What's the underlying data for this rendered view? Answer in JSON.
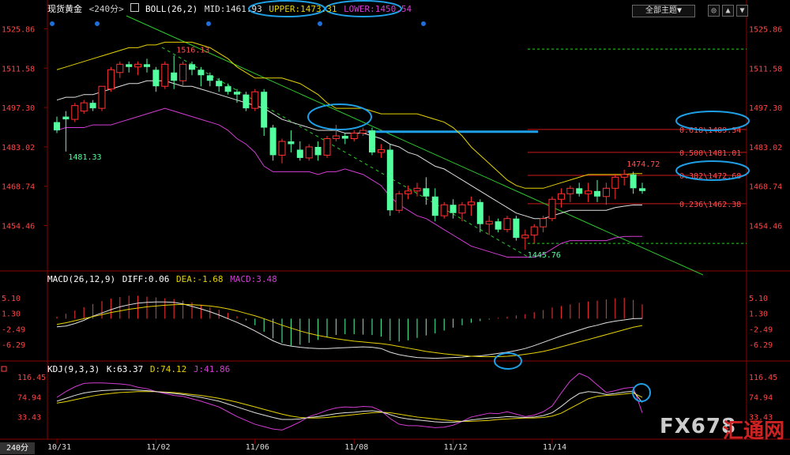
{
  "header": {
    "symbol": "现货黄金",
    "period": "<240分>",
    "indicator": "BOLL(26,2)",
    "mid": "MID:1461.93",
    "upper": "UPPER:1473.31",
    "lower": "LOWER:1450.54"
  },
  "toolbar": {
    "theme_label": "全部主题▼",
    "btn1": "◎",
    "btn2": "▲",
    "btn3": "▼"
  },
  "period_tab": "240分",
  "watermark": {
    "brand": "FX678",
    "cn": "汇通网"
  },
  "macd_header": {
    "name": "MACD(26,12,9)",
    "diff": "DIFF:0.06",
    "dea": "DEA:-1.68",
    "macd": "MACD:3.48"
  },
  "kdj_header": {
    "name": "KDJ(9,3,3)",
    "k": "K:63.37",
    "d": "D:74.12",
    "j": "J:41.86"
  },
  "colors": {
    "up": "#ff3232",
    "down": "#54ffa0",
    "mid": "#e0e0e0",
    "upper": "#e6d200",
    "lower": "#d23cd2",
    "fib": "#cc1a1a",
    "trend": "#2ecc2e",
    "highlight": "#1fa0e6"
  },
  "chart_data": [
    {
      "type": "candlestick",
      "title": "现货黄金",
      "y_ticks": [
        "1525.86",
        "1511.58",
        "1497.30",
        "1483.02",
        "1468.74",
        "1454.46"
      ],
      "ylim": [
        1440,
        1530
      ],
      "x_ticks": [
        {
          "index": 0,
          "label": "10/31"
        },
        {
          "index": 11,
          "label": "11/02"
        },
        {
          "index": 22,
          "label": "11/06"
        },
        {
          "index": 33,
          "label": "11/08"
        },
        {
          "index": 44,
          "label": "11/12"
        },
        {
          "index": 55,
          "label": "11/14"
        }
      ],
      "candles": [
        [
          1492,
          1494,
          1488,
          1489
        ],
        [
          1494,
          1496,
          1481.33,
          1493
        ],
        [
          1493,
          1499,
          1492,
          1498
        ],
        [
          1496,
          1500,
          1495,
          1499
        ],
        [
          1499,
          1500,
          1496,
          1497
        ],
        [
          1497,
          1504,
          1496,
          1505
        ],
        [
          1504,
          1512,
          1503,
          1511
        ],
        [
          1510,
          1514,
          1508,
          1513
        ],
        [
          1513,
          1514,
          1510,
          1512
        ],
        [
          1512,
          1514,
          1509,
          1513
        ],
        [
          1513,
          1515,
          1510,
          1512
        ],
        [
          1511,
          1512,
          1503,
          1505
        ],
        [
          1505,
          1514,
          1504,
          1513
        ],
        [
          1510,
          1516.13,
          1504,
          1507
        ],
        [
          1507,
          1514,
          1505,
          1513
        ],
        [
          1513,
          1514,
          1509,
          1511
        ],
        [
          1511,
          1512,
          1505,
          1509
        ],
        [
          1509,
          1510,
          1505,
          1507
        ],
        [
          1507,
          1508,
          1503,
          1505
        ],
        [
          1505,
          1506,
          1502,
          1503
        ],
        [
          1503,
          1504,
          1499,
          1502
        ],
        [
          1502,
          1503,
          1496,
          1497
        ],
        [
          1497,
          1504,
          1496,
          1503
        ],
        [
          1503,
          1504,
          1487,
          1490
        ],
        [
          1490,
          1491,
          1478,
          1480
        ],
        [
          1480,
          1486,
          1477,
          1485
        ],
        [
          1485,
          1489,
          1481,
          1484
        ],
        [
          1482,
          1485,
          1478,
          1479
        ],
        [
          1479,
          1484,
          1478,
          1483
        ],
        [
          1483,
          1485,
          1478,
          1480
        ],
        [
          1480,
          1487,
          1479,
          1486
        ],
        [
          1486,
          1491,
          1485,
          1487
        ],
        [
          1487,
          1488,
          1484,
          1486
        ],
        [
          1486,
          1489,
          1485,
          1488
        ],
        [
          1488,
          1490,
          1487,
          1489
        ],
        [
          1489,
          1490,
          1480,
          1481
        ],
        [
          1481,
          1484,
          1479,
          1482
        ],
        [
          1482,
          1484,
          1458,
          1460
        ],
        [
          1460,
          1467,
          1459,
          1466
        ],
        [
          1466,
          1469,
          1464,
          1467
        ],
        [
          1467,
          1470,
          1465,
          1468
        ],
        [
          1468,
          1472,
          1462,
          1465
        ],
        [
          1465,
          1468,
          1456,
          1458
        ],
        [
          1458,
          1463,
          1457,
          1462
        ],
        [
          1462,
          1464,
          1457,
          1459
        ],
        [
          1459,
          1463,
          1456,
          1462
        ],
        [
          1462,
          1465,
          1458,
          1463
        ],
        [
          1463,
          1464,
          1452,
          1455
        ],
        [
          1455,
          1458,
          1451,
          1456
        ],
        [
          1456,
          1457,
          1452,
          1453
        ],
        [
          1453,
          1458,
          1452,
          1457
        ],
        [
          1457,
          1458,
          1449,
          1450
        ],
        [
          1450,
          1453,
          1445.76,
          1451
        ],
        [
          1451,
          1455,
          1448,
          1454
        ],
        [
          1454,
          1458,
          1452,
          1457
        ],
        [
          1457,
          1465,
          1456,
          1464
        ],
        [
          1464,
          1468,
          1461,
          1466
        ],
        [
          1466,
          1469,
          1463,
          1468
        ],
        [
          1468,
          1470,
          1465,
          1466
        ],
        [
          1466,
          1470,
          1463,
          1467
        ],
        [
          1467,
          1471,
          1463,
          1465
        ],
        [
          1465,
          1470,
          1462,
          1468
        ],
        [
          1468,
          1473,
          1464,
          1472
        ],
        [
          1472,
          1474.72,
          1469,
          1473
        ],
        [
          1473,
          1474,
          1466,
          1468
        ],
        [
          1468,
          1470,
          1466,
          1467
        ]
      ],
      "boll_mid": [
        1500,
        1501,
        1501,
        1502,
        1502,
        1503,
        1504,
        1505,
        1506,
        1506,
        1507,
        1507,
        1507,
        1506,
        1505,
        1505,
        1504,
        1503,
        1502,
        1501,
        1500,
        1499,
        1498,
        1497,
        1495,
        1493,
        1492,
        1491,
        1490,
        1489,
        1489,
        1489,
        1488,
        1488,
        1488,
        1487,
        1486,
        1484,
        1483,
        1481,
        1480,
        1478,
        1476,
        1475,
        1473,
        1471,
        1469,
        1467,
        1465,
        1463,
        1461,
        1459,
        1458,
        1457,
        1457,
        1458,
        1459,
        1460,
        1460,
        1460,
        1460,
        1460,
        1461,
        1461.5,
        1461.93,
        1461.93
      ],
      "boll_upper": [
        1511,
        1512,
        1513,
        1514,
        1515,
        1516,
        1517,
        1518,
        1519,
        1519,
        1520,
        1520,
        1521,
        1521,
        1521,
        1521,
        1520,
        1519,
        1517,
        1515,
        1512,
        1510,
        1508,
        1508,
        1508,
        1508,
        1507,
        1506,
        1504,
        1502,
        1499,
        1497,
        1497,
        1497,
        1497,
        1496,
        1495,
        1495,
        1495,
        1495,
        1495,
        1494,
        1493,
        1492,
        1490,
        1487,
        1483,
        1480,
        1477,
        1474,
        1471,
        1469,
        1468,
        1468,
        1468,
        1469,
        1470,
        1471,
        1472,
        1473,
        1473,
        1473,
        1473,
        1473,
        1473.31,
        1473.31
      ],
      "boll_lower": [
        1489,
        1490,
        1490,
        1490,
        1491,
        1491,
        1491,
        1492,
        1493,
        1494,
        1495,
        1496,
        1497,
        1496,
        1495,
        1494,
        1493,
        1492,
        1491,
        1489,
        1486,
        1484,
        1481,
        1476,
        1474,
        1474,
        1474,
        1474,
        1474,
        1473,
        1474,
        1474,
        1475,
        1474,
        1473,
        1471,
        1469,
        1465,
        1462,
        1460,
        1458,
        1457,
        1455,
        1453,
        1451,
        1449,
        1447,
        1446,
        1445,
        1444,
        1443,
        1443,
        1443,
        1443,
        1444,
        1446,
        1448,
        1449,
        1449,
        1449,
        1449,
        1449,
        1450,
        1450.5,
        1450.54,
        1450.54
      ],
      "annotations": [
        {
          "label": "1516.13",
          "index": 13,
          "value": 1516.13
        },
        {
          "label": "1481.33",
          "index": 1,
          "value": 1481.33
        },
        {
          "label": "1445.76",
          "index": 52,
          "value": 1445.76
        },
        {
          "label": "1474.72",
          "index": 63,
          "value": 1474.72
        }
      ],
      "fib_levels": [
        {
          "label": "0.618\\1489.34",
          "value": 1489.34
        },
        {
          "label": "0.500\\1481.01",
          "value": 1481.01
        },
        {
          "label": "0.382\\1472.68",
          "value": 1472.68
        },
        {
          "label": "0.236\\1462.38",
          "value": 1462.38
        }
      ],
      "dashed_levels": [
        1518.5,
        1448
      ]
    },
    {
      "type": "bar",
      "title": "MACD(26,12,9)",
      "y_ticks": [
        "5.10",
        "1.30",
        "-2.49",
        "-6.29"
      ],
      "ylim": [
        -9,
        8
      ],
      "macd": [
        0.5,
        1.2,
        2.0,
        2.8,
        3.6,
        4.3,
        4.9,
        5.3,
        5.6,
        5.6,
        5.4,
        5.2,
        5.0,
        4.8,
        4.4,
        4.0,
        3.4,
        2.8,
        2.2,
        1.4,
        0.6,
        -0.4,
        -1.6,
        -3.2,
        -4.8,
        -5.9,
        -6.6,
        -6.4,
        -5.9,
        -5.2,
        -4.6,
        -4.0,
        -3.8,
        -3.8,
        -3.9,
        -4.0,
        -4.4,
        -5.4,
        -5.6,
        -5.3,
        -4.7,
        -4.1,
        -3.6,
        -2.9,
        -2.2,
        -1.6,
        -1.0,
        -0.6,
        -0.2,
        0.2,
        0.5,
        0.8,
        1.1,
        1.6,
        2.1,
        2.7,
        3.1,
        3.5,
        3.9,
        4.2,
        4.4,
        4.7,
        5.0,
        5.1,
        4.6,
        3.48
      ],
      "diff": [
        -2.0,
        -1.8,
        -1.2,
        -0.4,
        0.6,
        1.4,
        2.2,
        2.9,
        3.4,
        3.8,
        4.0,
        4.1,
        4.1,
        4.0,
        3.6,
        3.0,
        2.4,
        1.7,
        0.9,
        0.0,
        -0.9,
        -1.9,
        -3.0,
        -4.2,
        -5.4,
        -6.3,
        -6.7,
        -7.0,
        -7.2,
        -7.3,
        -7.3,
        -7.2,
        -7.1,
        -7.0,
        -6.9,
        -7.0,
        -7.3,
        -8.2,
        -8.8,
        -9.2,
        -9.5,
        -9.6,
        -9.7,
        -9.6,
        -9.5,
        -9.4,
        -9.2,
        -9.1,
        -8.8,
        -8.5,
        -8.2,
        -7.8,
        -7.3,
        -6.6,
        -5.8,
        -5.0,
        -4.2,
        -3.5,
        -2.8,
        -2.1,
        -1.6,
        -1.0,
        -0.6,
        -0.3,
        0.0,
        0.06
      ],
      "dea": [
        -1.4,
        -1.0,
        -0.5,
        0.0,
        0.5,
        1.0,
        1.5,
        1.9,
        2.3,
        2.6,
        2.9,
        3.1,
        3.3,
        3.4,
        3.5,
        3.4,
        3.3,
        3.1,
        2.8,
        2.4,
        1.9,
        1.3,
        0.7,
        0.0,
        -0.8,
        -1.6,
        -2.3,
        -3.0,
        -3.6,
        -4.1,
        -4.5,
        -4.9,
        -5.2,
        -5.5,
        -5.7,
        -5.9,
        -6.1,
        -6.4,
        -6.8,
        -7.2,
        -7.6,
        -8.0,
        -8.3,
        -8.6,
        -8.8,
        -9.0,
        -9.2,
        -9.3,
        -9.3,
        -9.3,
        -9.2,
        -9.0,
        -8.7,
        -8.4,
        -8.0,
        -7.5,
        -6.9,
        -6.3,
        -5.7,
        -5.1,
        -4.5,
        -3.9,
        -3.3,
        -2.7,
        -2.1,
        -1.68
      ]
    },
    {
      "type": "line",
      "title": "KDJ(9,3,3)",
      "y_ticks": [
        "116.45",
        "74.94",
        "33.43"
      ],
      "ylim": [
        0,
        125
      ],
      "k": [
        66,
        72,
        78,
        83,
        86,
        88,
        89,
        90,
        90,
        89,
        88,
        86,
        84,
        82,
        80,
        77,
        74,
        70,
        66,
        60,
        54,
        48,
        42,
        37,
        32,
        28,
        28,
        29,
        32,
        34,
        37,
        40,
        42,
        43,
        45,
        46,
        44,
        38,
        32,
        29,
        27,
        25,
        23,
        22,
        22,
        24,
        27,
        29,
        31,
        32,
        34,
        33,
        32,
        33,
        36,
        42,
        55,
        70,
        82,
        86,
        84,
        80,
        82,
        85,
        87,
        63.37
      ],
      "d": [
        62,
        65,
        69,
        73,
        77,
        80,
        82,
        84,
        85,
        86,
        86,
        86,
        85,
        84,
        82,
        80,
        78,
        75,
        72,
        68,
        64,
        59,
        54,
        49,
        44,
        39,
        35,
        32,
        31,
        31,
        32,
        34,
        36,
        38,
        40,
        42,
        43,
        42,
        39,
        36,
        33,
        31,
        29,
        27,
        25,
        24,
        24,
        25,
        26,
        28,
        29,
        30,
        31,
        31,
        32,
        35,
        41,
        51,
        61,
        71,
        76,
        78,
        79,
        81,
        83,
        74.12
      ],
      "j": [
        74,
        86,
        96,
        103,
        104,
        104,
        103,
        102,
        100,
        95,
        92,
        86,
        82,
        78,
        76,
        71,
        66,
        60,
        54,
        44,
        34,
        26,
        18,
        13,
        8,
        6,
        14,
        23,
        34,
        40,
        47,
        52,
        54,
        53,
        55,
        54,
        46,
        30,
        18,
        15,
        15,
        13,
        11,
        12,
        16,
        24,
        33,
        37,
        41,
        40,
        44,
        39,
        34,
        37,
        44,
        56,
        83,
        108,
        124,
        116,
        100,
        84,
        88,
        93,
        95,
        41.86
      ]
    }
  ]
}
